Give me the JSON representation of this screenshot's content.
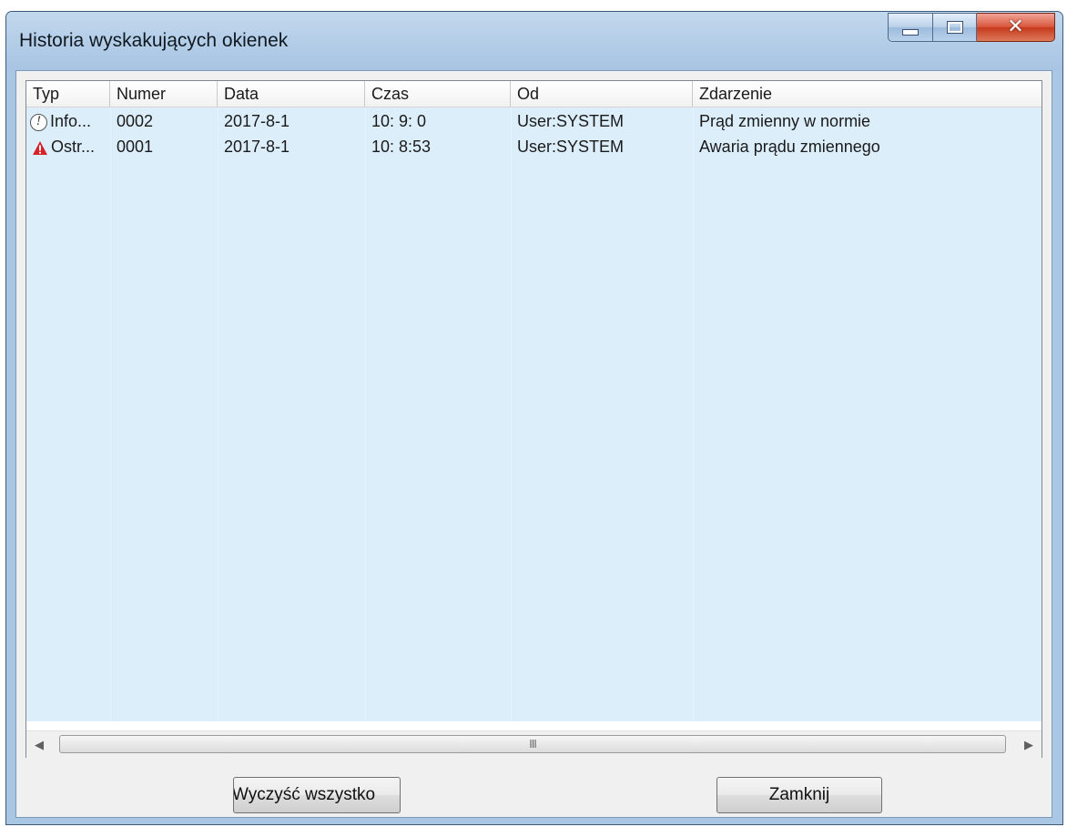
{
  "window": {
    "title": "Historia wyskakujących okienek",
    "caption_buttons": [
      "minimize",
      "maximize",
      "close"
    ]
  },
  "list": {
    "columns": [
      "Typ",
      "Numer",
      "Data",
      "Czas",
      "Od",
      "Zdarzenie"
    ],
    "rows": [
      {
        "icon": "info-icon",
        "type": "Info...",
        "number": "0002",
        "date": "2017-8-1",
        "time": "10: 9: 0",
        "from": "User:SYSTEM",
        "event": "Prąd zmienny w normie"
      },
      {
        "icon": "warning-icon",
        "type": "Ostr...",
        "number": "0001",
        "date": "2017-8-1",
        "time": "10: 8:53",
        "from": "User:SYSTEM",
        "event": "Awaria prądu zmiennego"
      }
    ]
  },
  "scrollbar": {
    "grip": "III"
  },
  "buttons": {
    "clear_all": "Wyczyść wszystko",
    "close": "Zamknij"
  },
  "colors": {
    "row_background": "#ddeefb",
    "warning": "#d8222a",
    "frame": "#a9c6e3"
  }
}
